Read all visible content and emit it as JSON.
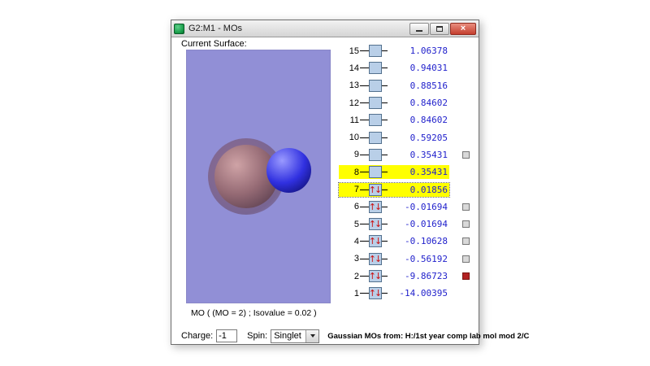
{
  "window": {
    "title": "G2:M1 - MOs",
    "close_glyph": "×"
  },
  "left_panel": {
    "surface_label": "Current Surface:",
    "caption": "MO ( (MO = 2) ; Isovalue = 0.02 )"
  },
  "mo_panel": {
    "arrow_glyphs": "↑↓",
    "rows": [
      {
        "n": "15",
        "energy": "1.06378",
        "occ": false,
        "hl": false,
        "focus": false,
        "check": "none"
      },
      {
        "n": "14",
        "energy": "0.94031",
        "occ": false,
        "hl": false,
        "focus": false,
        "check": "none"
      },
      {
        "n": "13",
        "energy": "0.88516",
        "occ": false,
        "hl": false,
        "focus": false,
        "check": "none"
      },
      {
        "n": "12",
        "energy": "0.84602",
        "occ": false,
        "hl": false,
        "focus": false,
        "check": "none"
      },
      {
        "n": "11",
        "energy": "0.84602",
        "occ": false,
        "hl": false,
        "focus": false,
        "check": "none"
      },
      {
        "n": "10",
        "energy": "0.59205",
        "occ": false,
        "hl": false,
        "focus": false,
        "check": "none"
      },
      {
        "n": "9",
        "energy": "0.35431",
        "occ": false,
        "hl": false,
        "focus": false,
        "check": "gray"
      },
      {
        "n": "8",
        "energy": "0.35431",
        "occ": false,
        "hl": true,
        "focus": false,
        "check": "none"
      },
      {
        "n": "7",
        "energy": "0.01856",
        "occ": true,
        "hl": true,
        "focus": true,
        "check": "none"
      },
      {
        "n": "6",
        "energy": "-0.01694",
        "occ": true,
        "hl": false,
        "focus": false,
        "check": "gray"
      },
      {
        "n": "5",
        "energy": "-0.01694",
        "occ": true,
        "hl": false,
        "focus": false,
        "check": "gray"
      },
      {
        "n": "4",
        "energy": "-0.10628",
        "occ": true,
        "hl": false,
        "focus": false,
        "check": "gray"
      },
      {
        "n": "3",
        "energy": "-0.56192",
        "occ": true,
        "hl": false,
        "focus": false,
        "check": "gray"
      },
      {
        "n": "2",
        "energy": "-9.86723",
        "occ": true,
        "hl": false,
        "focus": false,
        "check": "red"
      },
      {
        "n": "1",
        "energy": "-14.00395",
        "occ": true,
        "hl": false,
        "focus": false,
        "check": "none"
      }
    ]
  },
  "footer": {
    "charge_label": "Charge:",
    "charge_value": "-1",
    "spin_label": "Spin:",
    "spin_value": "Singlet",
    "source_text": "Gaussian MOs from:  H:/1st year comp lab mol mod 2/C"
  },
  "colors": {
    "viewport_bg": "#918fd6",
    "highlight": "#ffff00",
    "energy_text": "#2222cc",
    "occupied_arrow": "#cc1111",
    "red_checkbox": "#b22222"
  }
}
